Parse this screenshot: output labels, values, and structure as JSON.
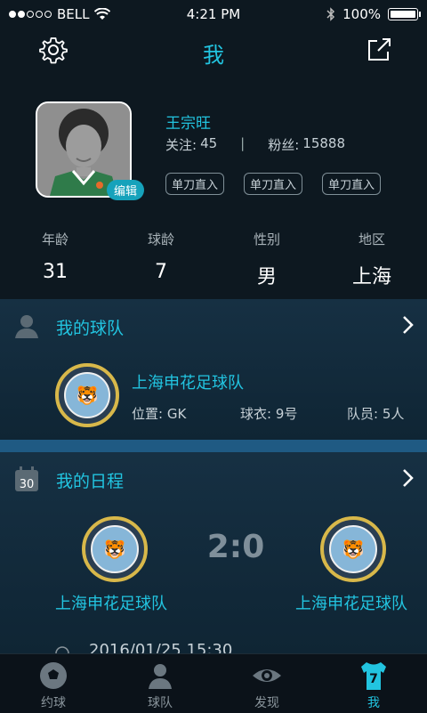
{
  "status_bar": {
    "carrier": "BELL",
    "time": "4:21 PM",
    "battery": "100%"
  },
  "nav": {
    "title": "我"
  },
  "profile": {
    "name": "王宗旺",
    "follow_label": "关注:",
    "follow_count": "45",
    "separator": "|",
    "fans_label": "粉丝:",
    "fans_count": "15888",
    "edit_label": "编辑",
    "tags": [
      "单刀直入",
      "单刀直入",
      "单刀直入"
    ]
  },
  "info": [
    {
      "key": "年龄",
      "value": "31"
    },
    {
      "key": "球龄",
      "value": "7"
    },
    {
      "key": "性别",
      "value": "男"
    },
    {
      "key": "地区",
      "value": "上海"
    }
  ],
  "my_team": {
    "title": "我的球队",
    "team_name": "上海申花足球队",
    "position_label": "位置:",
    "position_value": "GK",
    "jersey_label": "球衣:",
    "jersey_value": "9号",
    "members_label": "队员:",
    "members_value": "5人"
  },
  "schedule": {
    "title": "我的日程",
    "calendar_day": "30",
    "home_team": "上海申花足球队",
    "away_team": "上海申花足球队",
    "score": "2:0",
    "datetime": "2016/01/25  15:30"
  },
  "tabbar": {
    "items": [
      {
        "label": "约球",
        "icon": "soccer-ball-icon"
      },
      {
        "label": "球队",
        "icon": "team-icon"
      },
      {
        "label": "发现",
        "icon": "eye-icon"
      },
      {
        "label": "我",
        "icon": "jersey-icon",
        "badge": "7"
      }
    ],
    "active_index": 3
  },
  "colors": {
    "accent": "#22c4e0",
    "background": "#0d1820",
    "card": "#163043"
  }
}
